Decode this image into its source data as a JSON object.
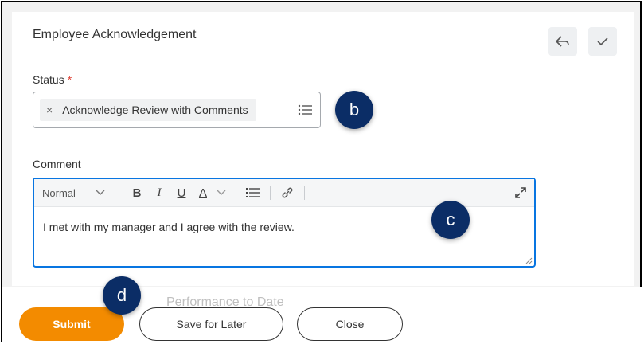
{
  "card": {
    "title": "Employee Acknowledgement"
  },
  "status": {
    "label": "Status",
    "required_marker": "*",
    "selected_value": "Acknowledge Review with Comments",
    "remove_glyph": "×"
  },
  "comment": {
    "label": "Comment",
    "toolbar": {
      "format_select": "Normal",
      "bold": "B",
      "italic": "I",
      "underline": "U",
      "text_color": "A"
    },
    "text": "I met with my manager and I agree with the review."
  },
  "footer": {
    "background_text": "Performance to Date",
    "submit_label": "Submit",
    "save_label": "Save for Later",
    "close_label": "Close"
  },
  "annotations": {
    "b": "b",
    "c": "c",
    "d": "d"
  },
  "icons": {
    "header_actions": [
      "reply-icon",
      "checkmark-icon"
    ],
    "status_prompt": "list-icon",
    "toolbar": [
      "chevron-down-icon",
      "bulleted-list-icon",
      "link-icon",
      "expand-icon"
    ]
  },
  "colors": {
    "primary_button": "#f38b00",
    "focus_border": "#0875e1",
    "required": "#de4034",
    "annotation_badge": "#0b2d66"
  }
}
